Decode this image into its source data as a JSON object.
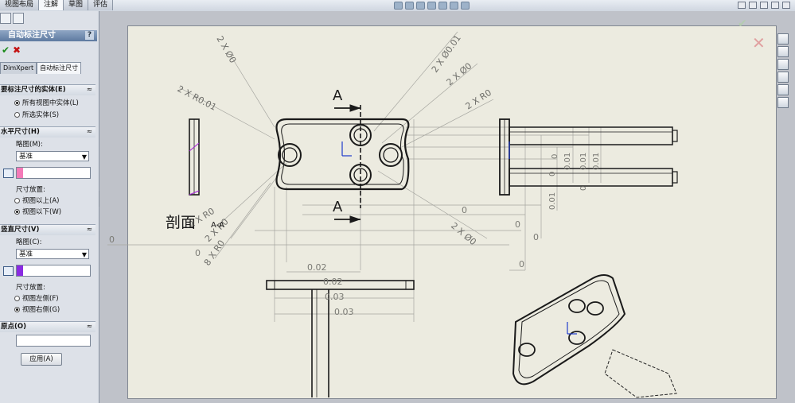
{
  "tabs": [
    "视图布局",
    "注解",
    "草图",
    "评估"
  ],
  "active_tab": "注解",
  "property_manager": {
    "title": "自动标注尺寸",
    "help": "?",
    "subtabs": [
      "DimXpert",
      "自动标注尺寸"
    ],
    "entities_group": {
      "title": "要标注尺寸的实体(E)",
      "options": [
        "所有视图中实体(L)",
        "所选实体(S)"
      ],
      "selected": 0
    },
    "horizontal_group": {
      "title": "水平尺寸(H)",
      "scheme_label": "略图(M):",
      "scheme_value": "基准",
      "placement_label": "尺寸放置:",
      "options": [
        "视图以上(A)",
        "视图以下(W)"
      ],
      "selected": 1,
      "color": "#f47ab8"
    },
    "vertical_group": {
      "title": "竖直尺寸(V)",
      "scheme_label": "略图(C):",
      "scheme_value": "基准",
      "placement_label": "尺寸放置:",
      "options": [
        "视图左侧(F)",
        "视图右侧(G)"
      ],
      "selected": 1,
      "color": "#8a2be2"
    },
    "origin_group": {
      "title": "原点(O)",
      "apply_label": "应用(A)"
    }
  },
  "drawing": {
    "section_label": "剖面",
    "section_suffix": "A-A",
    "cut_letter": "A",
    "callouts": [
      "2 X Ø0",
      "2 X Ø0.01",
      "2 X Ø0",
      "2 X R0",
      "2 X R0.01",
      "2 X R0",
      "2 X R0",
      "8 X R0",
      "2 X Ø0"
    ],
    "horizontal_dims": [
      "0",
      "0",
      "0",
      "0.02",
      "0.02",
      "0.03",
      "0.03",
      "0",
      "0",
      "0"
    ],
    "vertical_dims": [
      "0.01",
      "0.01",
      "0.01",
      "0.01",
      "0",
      "0",
      "0"
    ]
  }
}
